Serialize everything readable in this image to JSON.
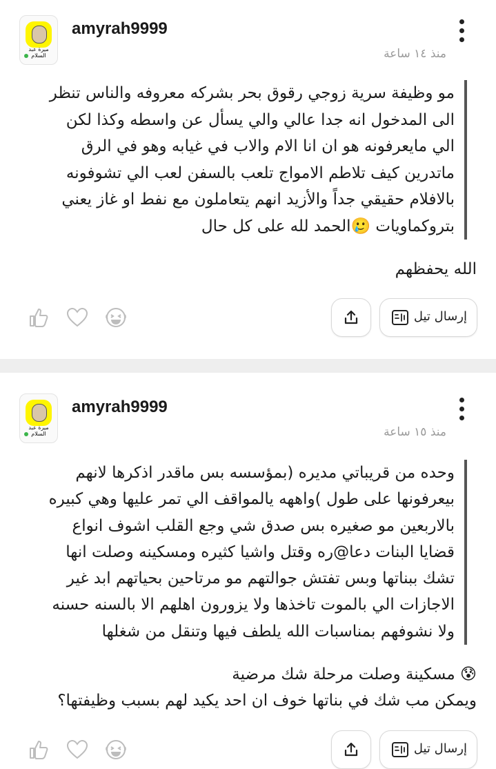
{
  "posts": [
    {
      "username": "amyrah9999",
      "time": "منذ ١٤ ساعة",
      "avatar_caption": "ميرة عبد السلام",
      "quote_lines": [
        "مو وظيفة سرية زوجي رقوق بحر بشركه معروفه والناس تنظر",
        "الى المدخول  انه جدا عالي والي يسأل عن واسطه وكذا لكن",
        "الي مايعرفونه هو ان انا الام والاب في غيابه وهو في الرق",
        "ماتدرين كيف تلاطم الامواج تلعب بالسفن لعب  الي تشوفونه",
        "بالافلام حقيقي جداً والأزيد انهم يتعاملون مع نفط او غاز يعني",
        "بتروكماويات 🥲الحمد لله على كل حال"
      ],
      "body_lines": [
        "الله يحفظهم"
      ],
      "send_label": "إرسال تيل"
    },
    {
      "username": "amyrah9999",
      "time": "منذ ١٥ ساعة",
      "avatar_caption": "ميرة عبد السلام",
      "quote_lines": [
        "وحده من قريباتي مديره  (بمؤسسه بس ماقدر اذكرها لانهم",
        "بيعرفونها على طول )واههه يالمواقف الي تمر عليها وهي كبيره",
        "بالاربعين مو صغيره بس صدق شي وجع القلب اشوف انواع",
        "قضايا البنات  دعا@ره وقتل واشيا كثيره ومسكينه وصلت انها",
        "تشك ببناتها وبس تفتش جوالتهم مو مرتاحين بحياتهم ابد غير",
        "الاجازات الي بالموت تاخذها ولا يزورون اهلهم الا بالسنه حسنه",
        "ولا نشوفهم بمناسبات  الله يلطف فيها وتنقل من شغلها"
      ],
      "body_lines": [
        "😰 مسكينة وصلت مرحلة شك مرضية",
        "ويمكن مب شك في بناتها خوف ان احد يكيد لهم بسبب وظيفتها؟"
      ],
      "send_label": "إرسال تيل"
    }
  ],
  "icons": {
    "like": "thumbs-up-icon",
    "love": "heart-icon",
    "laugh": "laughing-face-icon",
    "share": "share-icon",
    "send": "tile-card-icon",
    "more": "more-vertical-icon"
  },
  "colors": {
    "text": "#1c1c1c",
    "muted": "#9a9a9a",
    "snap_yellow": "#fff500",
    "separator": "#eeeeee"
  }
}
